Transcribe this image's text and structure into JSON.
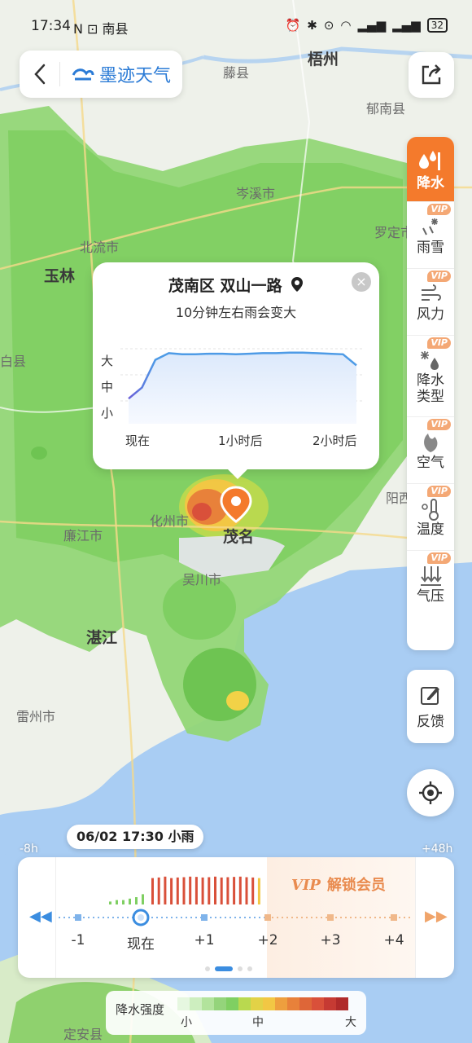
{
  "status_bar": {
    "time": "17:34",
    "carrier": "N ⊡ 南县",
    "battery": "32"
  },
  "header": {
    "app_name": "墨迹天气"
  },
  "map": {
    "labels": {
      "wuzhou": "梧州",
      "tengxian": "藤县",
      "yunan": "郁南县",
      "cenxi": "岑溪市",
      "luoding": "罗定市",
      "beiliu": "北流市",
      "yulin": "玉林",
      "bobai": "白县",
      "huazhou": "化州市",
      "maoming": "茂名",
      "yangjiang": "阳西",
      "lianjiang": "廉江市",
      "wuchuan": "吴川市",
      "zhanjiang": "湛江",
      "leizhou": "雷州市",
      "dingan": "定安县"
    }
  },
  "layers": [
    {
      "label": "降水",
      "icon": "rain-layer-icon",
      "vip": false,
      "active": true
    },
    {
      "label": "雨雪",
      "icon": "snow-layer-icon",
      "vip": true,
      "active": false
    },
    {
      "label": "风力",
      "icon": "wind-layer-icon",
      "vip": true,
      "active": false
    },
    {
      "label": "降水类型",
      "icon": "precip-type-icon",
      "vip": true,
      "active": false
    },
    {
      "label": "空气",
      "icon": "air-layer-icon",
      "vip": true,
      "active": false
    },
    {
      "label": "温度",
      "icon": "temp-layer-icon",
      "vip": true,
      "active": false
    },
    {
      "label": "气压",
      "icon": "pressure-layer-icon",
      "vip": true,
      "active": false
    }
  ],
  "vip_badge": "VIP",
  "feedback": {
    "label": "反馈"
  },
  "popup": {
    "location": "茂南区 双山一路",
    "summary": "10分钟左右雨会变大",
    "y_labels": {
      "high": "大",
      "mid": "中",
      "low": "小"
    },
    "x_labels": {
      "now": "现在",
      "one_hour": "1小时后",
      "two_hour": "2小时后"
    }
  },
  "chart_data": {
    "type": "line",
    "x_ticks": [
      "现在",
      "1小时后",
      "2小时后"
    ],
    "y_categories": [
      "小",
      "中",
      "大"
    ],
    "series": [
      {
        "values": [
          0.1,
          0.3,
          0.8,
          0.92,
          0.9,
          0.9,
          0.91,
          0.91,
          0.9,
          0.91,
          0.92,
          0.92,
          0.93,
          0.93,
          0.92,
          0.91,
          0.9,
          0.7
        ]
      }
    ]
  },
  "timeline": {
    "current_label": "06/02 17:30  小雨",
    "left_edge": "-8h",
    "right_edge": "+48h",
    "ticks": [
      "-1",
      "现在",
      "+1",
      "+2",
      "+3",
      "+4"
    ],
    "vip_text": "VIP",
    "unlock_text": "解锁会员",
    "bars_green": [
      0.1,
      0.15,
      0.15,
      0.2,
      0.25,
      0.35
    ],
    "bars_red": [
      0.9,
      0.92,
      0.95,
      0.9,
      0.92,
      0.93,
      0.95,
      0.94,
      0.92,
      0.93,
      0.95,
      0.92,
      0.93,
      0.94,
      0.95,
      0.93,
      0.92,
      0.9
    ]
  },
  "legend": {
    "name": "降水强度",
    "low": "小",
    "mid": "中",
    "high": "大"
  },
  "colors": {
    "accent": "#f47a2c",
    "blue": "#3b8de0",
    "rain_green": "#7fcf62",
    "rain_red": "#d9503a"
  }
}
